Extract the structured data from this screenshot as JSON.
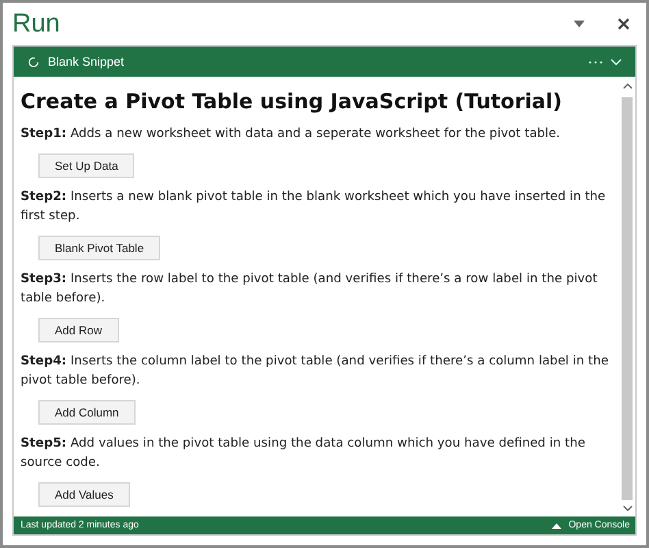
{
  "window": {
    "title": "Run"
  },
  "header": {
    "title": "Blank Snippet"
  },
  "content": {
    "heading": "Create a Pivot Table using JavaScript (Tutorial)",
    "steps": [
      {
        "label": "Step1:",
        "text": "Adds a new worksheet with data and a seperate worksheet for the pivot table.",
        "button": "Set Up Data"
      },
      {
        "label": "Step2:",
        "text": "Inserts a new blank pivot table in the blank worksheet which you have inserted in the first step.",
        "button": "Blank Pivot Table"
      },
      {
        "label": "Step3:",
        "text": "Inserts the row label to the pivot table (and verifies if there’s a row label in the pivot table before).",
        "button": "Add Row"
      },
      {
        "label": "Step4:",
        "text": "Inserts the column label to the pivot table (and verifies if there’s a column label in the pivot table before).",
        "button": "Add Column"
      },
      {
        "label": "Step5:",
        "text": "Add values in the pivot table using the data column which you have defined in the source code.",
        "button": "Add Values"
      }
    ]
  },
  "status_bar": {
    "updated": "Last updated 2 minutes ago",
    "console": "Open Console"
  }
}
